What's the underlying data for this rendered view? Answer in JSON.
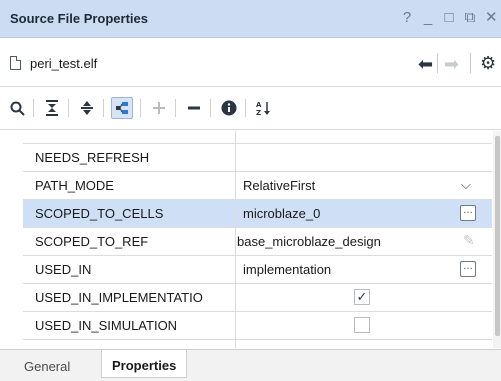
{
  "window": {
    "title": "Source File Properties",
    "controls": [
      "?",
      "_",
      "□",
      "⧉",
      "✕"
    ]
  },
  "file": {
    "name": "peri_test.elf",
    "icon": "file-icon"
  },
  "toolbar": {
    "buttons": [
      "search-icon",
      "collapse-all-icon",
      "expand-all-icon",
      "group-icon",
      "add-icon",
      "remove-icon",
      "info-icon",
      "sort-icon"
    ]
  },
  "properties": [
    {
      "name": "NEEDS_REFRESH",
      "value": ""
    },
    {
      "name": "PATH_MODE",
      "value": "RelativeFirst"
    },
    {
      "name": "SCOPED_TO_CELLS",
      "value": "microblaze_0"
    },
    {
      "name": "SCOPED_TO_REF",
      "value": "base_microblaze_design"
    },
    {
      "name": "USED_IN",
      "value": "implementation"
    },
    {
      "name": "USED_IN_IMPLEMENTATIO",
      "checked": true
    },
    {
      "name": "USED_IN_SIMULATION",
      "checked": false
    }
  ],
  "tabs": [
    {
      "label": "General"
    },
    {
      "label": "Properties"
    }
  ],
  "colors": {
    "title_bg": "#ccdcf2",
    "selected_row": "#cfe0f6"
  }
}
